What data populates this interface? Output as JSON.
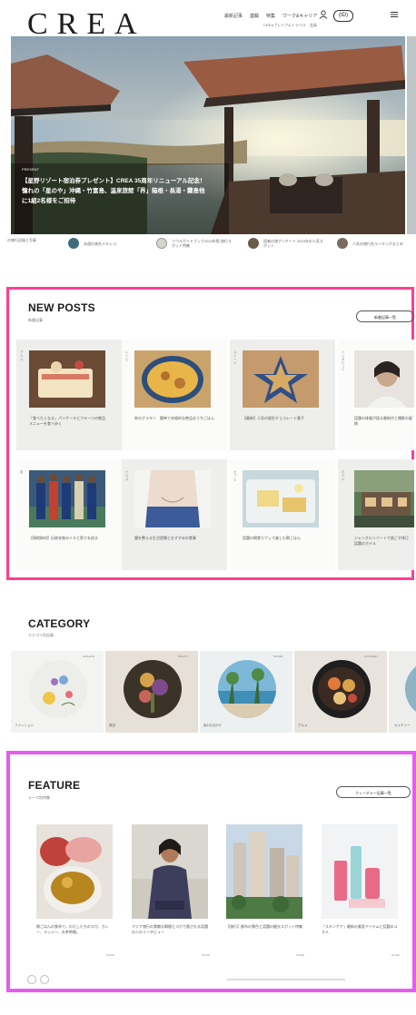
{
  "header": {
    "logo": "CREA",
    "nav": [
      "最新記事",
      "連載",
      "特集",
      "ワーク&キャリア",
      "著者一覧"
    ],
    "nav_sub": "CREAプレミアムトラベル　会員",
    "badge": "(ID)",
    "menu_icon": "menu-icon"
  },
  "hero": {
    "tag": "PRESENT",
    "title": "【星野リゾート宿泊券プレゼント】CREA 35周年リニューアル記念！ 憧れの「星のや」沖縄・竹富島、温泉旅館「界」箱根・長湯・霧島他に1組2名様をご招待"
  },
  "thumbs": [
    {
      "text": "の旅行記録と写真"
    },
    {
      "text": "永遠の旅先メキシコ"
    },
    {
      "text": "ソウルガイドブック2024年版 旅行スポット特集"
    },
    {
      "text": "読者の旅アンケート 2023年の人気スポット"
    },
    {
      "text": "人気の旅行先ランキングまとめ"
    }
  ],
  "new_posts": {
    "title": "NEW POSTS",
    "subtitle": "新着記事",
    "button": "新着記事一覧",
    "items": [
      {
        "label": "グルメ",
        "caption": "「食べたくなる」パンケーキとフルーツの絶品メニューを食べ歩く"
      },
      {
        "label": "レシピ",
        "caption": "秋のグラタン　簡単で本格的な絶品おうちごはん"
      },
      {
        "label": "スイーツ",
        "caption": "【最新】人気の星形チョコレート菓子"
      },
      {
        "label": "インタビュー",
        "caption": "話題の俳優が語る最新作と撮影の裏側"
      },
      {
        "label": "旅",
        "caption": "【現地取材】伝統衣装の人々と祭りを巡る"
      },
      {
        "label": "ヘルス",
        "caption": "腸を整える生活習慣とおすすめの食事"
      },
      {
        "label": "カフェ",
        "caption": "話題の朝食カフェで楽しむ朝ごはん"
      },
      {
        "label": "ホテル",
        "caption": "ジャングルリゾートで過ごす休日 話題のホテル"
      }
    ]
  },
  "category": {
    "title": "CATEGORY",
    "subtitle": "カテゴリ別記事",
    "items": [
      {
        "label": "ファッション",
        "tag": "FASHION"
      },
      {
        "label": "美容",
        "tag": "BEAUTY"
      },
      {
        "label": "旅&お出かけ",
        "tag": "TRAVEL"
      },
      {
        "label": "グルメ",
        "tag": "GOURMET"
      },
      {
        "label": "カルチャー",
        "tag": "CULTURE"
      }
    ]
  },
  "feature": {
    "title": "FEATURE",
    "subtitle": "テーマ別特集",
    "button": "フィーチャー記事一覧",
    "items": [
      {
        "caption": "朝ごはんの食卓で。わたしたちのヨガ、カレー、ラッシー、お茶時間。",
        "more": "MORE"
      },
      {
        "caption": "アジア旅行の素敵な瞬間とヨガで癒される話題の人のインタビュー",
        "more": "MORE"
      },
      {
        "caption": "【旅行】都市の景色と話題の観光スポット特集",
        "more": "MORE"
      },
      {
        "caption": "「スキンケア」最新の美容アイテムと話題のコスメ",
        "more": "MORE"
      }
    ]
  },
  "colors": {
    "pink_frame": "#ff3f8e",
    "violet_frame": "#e55cf0"
  }
}
